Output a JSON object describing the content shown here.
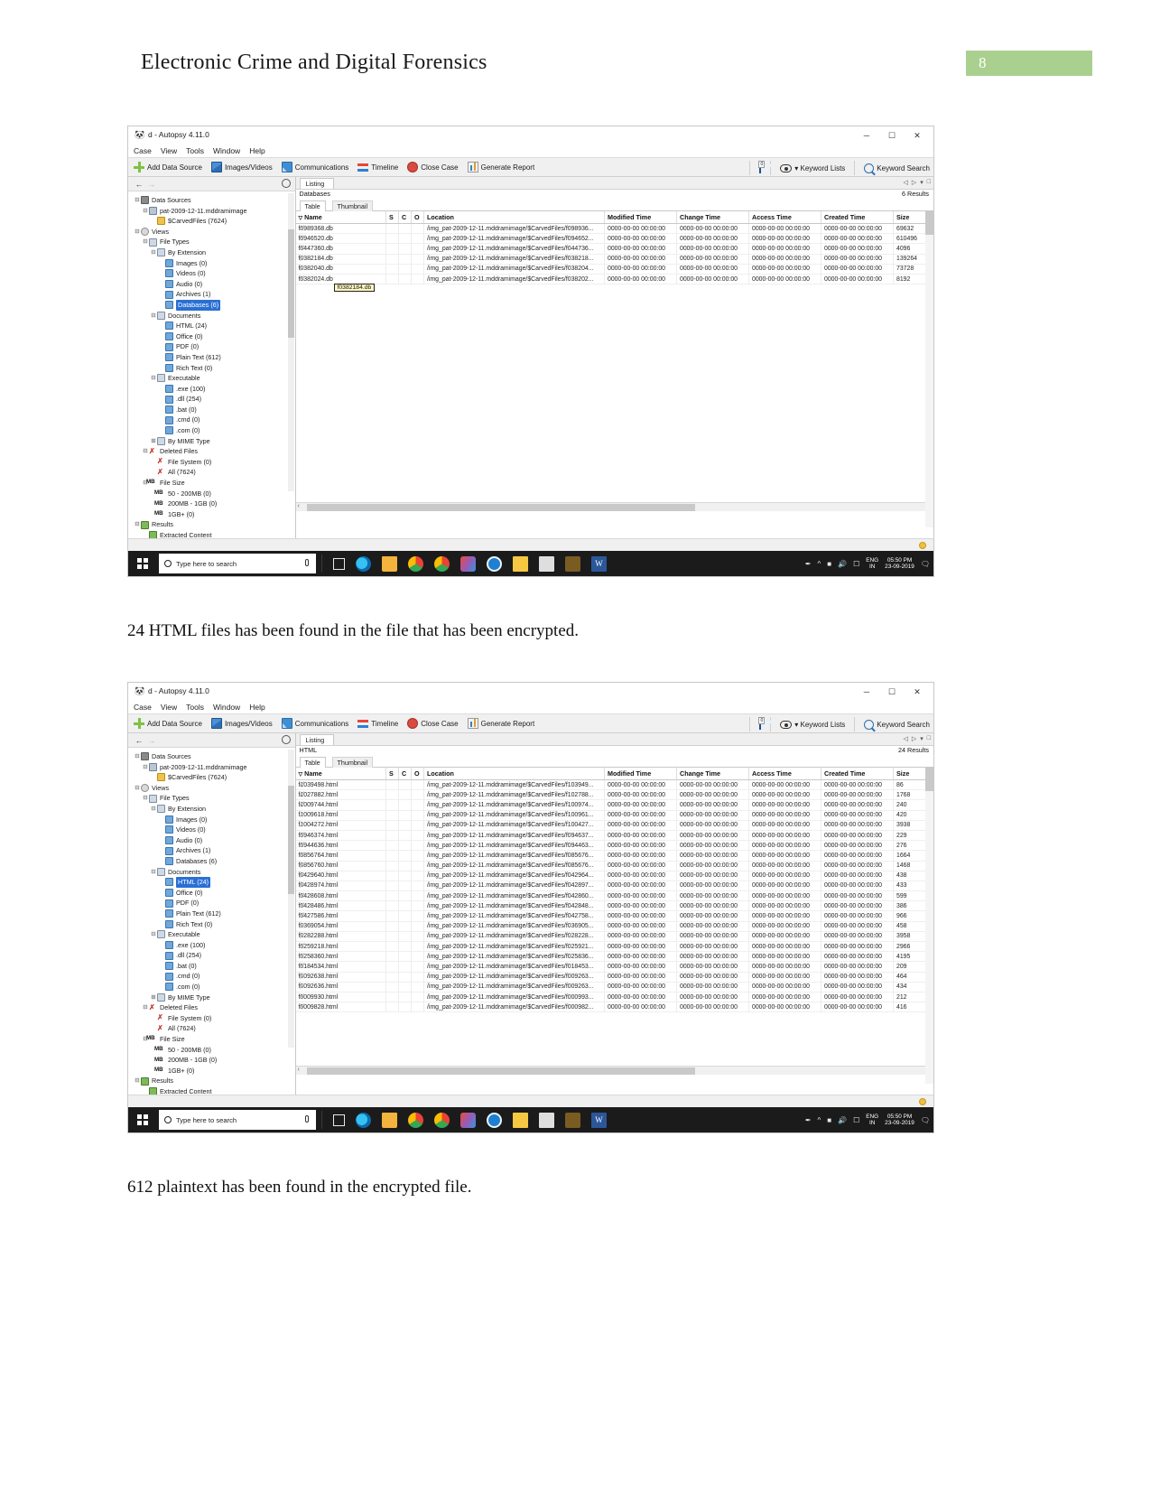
{
  "document": {
    "header_title": "Electronic Crime and Digital Forensics",
    "page_number": "8",
    "page_number_bg": "#a9d08e",
    "caption_1": "24 HTML files has been found in the file that has been encrypted.",
    "caption_2": "612 plaintext has been found in the encrypted file."
  },
  "app": {
    "title": "d - Autopsy 4.11.0",
    "menu": [
      "Case",
      "View",
      "Tools",
      "Window",
      "Help"
    ],
    "window_buttons": {
      "minimize": "─",
      "maximize": "☐",
      "close": "✕"
    },
    "toolbar": [
      {
        "label": "Add Data Source",
        "icon": "plus-icon"
      },
      {
        "label": "Images/Videos",
        "icon": "images-videos-icon"
      },
      {
        "label": "Communications",
        "icon": "communications-icon"
      },
      {
        "label": "Timeline",
        "icon": "timeline-icon"
      },
      {
        "label": "Close Case",
        "icon": "close-case-icon"
      },
      {
        "label": "Generate Report",
        "icon": "generate-report-icon"
      }
    ],
    "toolbar_right": {
      "mail_badge": "0",
      "keyword_lists": "▾ Keyword Lists",
      "keyword_search": "Keyword Search"
    },
    "nav": {
      "back": "←",
      "forward": "→"
    }
  },
  "tree": [
    {
      "depth": 0,
      "expander": "⊟",
      "icon": "drive-icon",
      "label": "Data Sources"
    },
    {
      "depth": 1,
      "expander": "⊟",
      "icon": "disk-icon",
      "label": "pat-2009-12-11.mddramimage"
    },
    {
      "depth": 2,
      "expander": "",
      "icon": "folder-icon",
      "label": "$CarvedFiles (7624)"
    },
    {
      "depth": 0,
      "expander": "⊟",
      "icon": "views-icon",
      "label": "Views"
    },
    {
      "depth": 1,
      "expander": "⊟",
      "icon": "types-icon",
      "label": "File Types"
    },
    {
      "depth": 2,
      "expander": "⊟",
      "icon": "types-icon",
      "label": "By Extension"
    },
    {
      "depth": 3,
      "expander": "",
      "icon": "file-icon",
      "label": "Images (0)"
    },
    {
      "depth": 3,
      "expander": "",
      "icon": "file-icon",
      "label": "Videos (0)"
    },
    {
      "depth": 3,
      "expander": "",
      "icon": "file-icon",
      "label": "Audio (0)"
    },
    {
      "depth": 3,
      "expander": "",
      "icon": "file-icon",
      "label": "Archives (1)"
    },
    {
      "depth": 3,
      "expander": "",
      "icon": "file-icon",
      "label": "Databases (6)"
    },
    {
      "depth": 2,
      "expander": "⊟",
      "icon": "types-icon",
      "label": "Documents"
    },
    {
      "depth": 3,
      "expander": "",
      "icon": "file-icon",
      "label": "HTML (24)"
    },
    {
      "depth": 3,
      "expander": "",
      "icon": "file-icon",
      "label": "Office (0)"
    },
    {
      "depth": 3,
      "expander": "",
      "icon": "file-icon",
      "label": "PDF (0)"
    },
    {
      "depth": 3,
      "expander": "",
      "icon": "file-icon",
      "label": "Plain Text (612)"
    },
    {
      "depth": 3,
      "expander": "",
      "icon": "file-icon",
      "label": "Rich Text (0)"
    },
    {
      "depth": 2,
      "expander": "⊟",
      "icon": "types-icon",
      "label": "Executable"
    },
    {
      "depth": 3,
      "expander": "",
      "icon": "file-icon",
      "label": ".exe (100)"
    },
    {
      "depth": 3,
      "expander": "",
      "icon": "file-icon",
      "label": ".dll (254)"
    },
    {
      "depth": 3,
      "expander": "",
      "icon": "file-icon",
      "label": ".bat (0)"
    },
    {
      "depth": 3,
      "expander": "",
      "icon": "file-icon",
      "label": ".cmd (0)"
    },
    {
      "depth": 3,
      "expander": "",
      "icon": "file-icon",
      "label": ".com (0)"
    },
    {
      "depth": 2,
      "expander": "⊞",
      "icon": "types-icon",
      "label": "By MIME Type"
    },
    {
      "depth": 1,
      "expander": "⊟",
      "icon": "deleted-icon",
      "label": "Deleted Files"
    },
    {
      "depth": 2,
      "expander": "",
      "icon": "deleted-icon",
      "label": "File System (0)"
    },
    {
      "depth": 2,
      "expander": "",
      "icon": "deleted-icon",
      "label": "All (7624)"
    },
    {
      "depth": 1,
      "expander": "⊟",
      "icon": "mb-icon",
      "label": "File Size"
    },
    {
      "depth": 2,
      "expander": "",
      "icon": "mb-icon",
      "label": "50 - 200MB (0)"
    },
    {
      "depth": 2,
      "expander": "",
      "icon": "mb-icon",
      "label": "200MB - 1GB (0)"
    },
    {
      "depth": 2,
      "expander": "",
      "icon": "mb-icon",
      "label": "1GB+ (0)"
    },
    {
      "depth": 0,
      "expander": "⊟",
      "icon": "results-icon",
      "label": "Results"
    },
    {
      "depth": 1,
      "expander": "",
      "icon": "results-icon",
      "label": "Extracted Content"
    }
  ],
  "listing": {
    "tab_label": "Listing",
    "view_tabs": {
      "active": "Table",
      "inactive": "Thumbnail"
    },
    "columns": [
      "Name",
      "S",
      "C",
      "O",
      "Location",
      "Modified Time",
      "Change Time",
      "Access Time",
      "Created Time",
      "Size"
    ]
  },
  "screenshot1": {
    "selected_tree_item": "Databases (6)",
    "listing_subtitle": "Databases",
    "results_count": "6 Results",
    "tooltip": "f0382184.db",
    "rows": [
      {
        "name": "f0989368.db",
        "location": "/img_pat-2009-12-11.mddramimage/$CarvedFiles/f098936...",
        "modified": "0000-00-00 00:00:00",
        "change": "0000-00-00 00:00:00",
        "access": "0000-00-00 00:00:00",
        "created": "0000-00-00 00:00:00",
        "size": "69632"
      },
      {
        "name": "f0946520.db",
        "location": "/img_pat-2009-12-11.mddramimage/$CarvedFiles/f094652...",
        "modified": "0000-00-00 00:00:00",
        "change": "0000-00-00 00:00:00",
        "access": "0000-00-00 00:00:00",
        "created": "0000-00-00 00:00:00",
        "size": "610496"
      },
      {
        "name": "f0447360.db",
        "location": "/img_pat-2009-12-11.mddramimage/$CarvedFiles/f044736...",
        "modified": "0000-00-00 00:00:00",
        "change": "0000-00-00 00:00:00",
        "access": "0000-00-00 00:00:00",
        "created": "0000-00-00 00:00:00",
        "size": "4096"
      },
      {
        "name": "f0382184.db",
        "location": "/img_pat-2009-12-11.mddramimage/$CarvedFiles/f038218...",
        "modified": "0000-00-00 00:00:00",
        "change": "0000-00-00 00:00:00",
        "access": "0000-00-00 00:00:00",
        "created": "0000-00-00 00:00:00",
        "size": "139264"
      },
      {
        "name": "f0382040.db",
        "location": "/img_pat-2009-12-11.mddramimage/$CarvedFiles/f038204...",
        "modified": "0000-00-00 00:00:00",
        "change": "0000-00-00 00:00:00",
        "access": "0000-00-00 00:00:00",
        "created": "0000-00-00 00:00:00",
        "size": "73728"
      },
      {
        "name": "f0382024.db",
        "location": "/img_pat-2009-12-11.mddramimage/$CarvedFiles/f038202...",
        "modified": "0000-00-00 00:00:00",
        "change": "0000-00-00 00:00:00",
        "access": "0000-00-00 00:00:00",
        "created": "0000-00-00 00:00:00",
        "size": "8192"
      }
    ]
  },
  "screenshot2": {
    "selected_tree_item": "HTML (24)",
    "listing_subtitle": "HTML",
    "results_count": "24 Results",
    "rows": [
      {
        "name": "f1039498.html",
        "location": "/img_pat-2009-12-11.mddramimage/$CarvedFiles/f103949...",
        "modified": "0000-00-00 00:00:00",
        "change": "0000-00-00 00:00:00",
        "access": "0000-00-00 00:00:00",
        "created": "0000-00-00 00:00:00",
        "size": "86"
      },
      {
        "name": "f1027882.html",
        "location": "/img_pat-2009-12-11.mddramimage/$CarvedFiles/f102788...",
        "modified": "0000-00-00 00:00:00",
        "change": "0000-00-00 00:00:00",
        "access": "0000-00-00 00:00:00",
        "created": "0000-00-00 00:00:00",
        "size": "1768"
      },
      {
        "name": "f1009744.html",
        "location": "/img_pat-2009-12-11.mddramimage/$CarvedFiles/f100974...",
        "modified": "0000-00-00 00:00:00",
        "change": "0000-00-00 00:00:00",
        "access": "0000-00-00 00:00:00",
        "created": "0000-00-00 00:00:00",
        "size": "240"
      },
      {
        "name": "f1009618.html",
        "location": "/img_pat-2009-12-11.mddramimage/$CarvedFiles/f100961...",
        "modified": "0000-00-00 00:00:00",
        "change": "0000-00-00 00:00:00",
        "access": "0000-00-00 00:00:00",
        "created": "0000-00-00 00:00:00",
        "size": "420"
      },
      {
        "name": "f1004272.html",
        "location": "/img_pat-2009-12-11.mddramimage/$CarvedFiles/f100427...",
        "modified": "0000-00-00 00:00:00",
        "change": "0000-00-00 00:00:00",
        "access": "0000-00-00 00:00:00",
        "created": "0000-00-00 00:00:00",
        "size": "3938"
      },
      {
        "name": "f0946374.html",
        "location": "/img_pat-2009-12-11.mddramimage/$CarvedFiles/f094637...",
        "modified": "0000-00-00 00:00:00",
        "change": "0000-00-00 00:00:00",
        "access": "0000-00-00 00:00:00",
        "created": "0000-00-00 00:00:00",
        "size": "229"
      },
      {
        "name": "f0944636.html",
        "location": "/img_pat-2009-12-11.mddramimage/$CarvedFiles/f094463...",
        "modified": "0000-00-00 00:00:00",
        "change": "0000-00-00 00:00:00",
        "access": "0000-00-00 00:00:00",
        "created": "0000-00-00 00:00:00",
        "size": "276"
      },
      {
        "name": "f0856764.html",
        "location": "/img_pat-2009-12-11.mddramimage/$CarvedFiles/f085676...",
        "modified": "0000-00-00 00:00:00",
        "change": "0000-00-00 00:00:00",
        "access": "0000-00-00 00:00:00",
        "created": "0000-00-00 00:00:00",
        "size": "1664"
      },
      {
        "name": "f0856760.html",
        "location": "/img_pat-2009-12-11.mddramimage/$CarvedFiles/f085676...",
        "modified": "0000-00-00 00:00:00",
        "change": "0000-00-00 00:00:00",
        "access": "0000-00-00 00:00:00",
        "created": "0000-00-00 00:00:00",
        "size": "1468"
      },
      {
        "name": "f0429640.html",
        "location": "/img_pat-2009-12-11.mddramimage/$CarvedFiles/f042964...",
        "modified": "0000-00-00 00:00:00",
        "change": "0000-00-00 00:00:00",
        "access": "0000-00-00 00:00:00",
        "created": "0000-00-00 00:00:00",
        "size": "438"
      },
      {
        "name": "f0428974.html",
        "location": "/img_pat-2009-12-11.mddramimage/$CarvedFiles/f042897...",
        "modified": "0000-00-00 00:00:00",
        "change": "0000-00-00 00:00:00",
        "access": "0000-00-00 00:00:00",
        "created": "0000-00-00 00:00:00",
        "size": "433"
      },
      {
        "name": "f0428608.html",
        "location": "/img_pat-2009-12-11.mddramimage/$CarvedFiles/f042860...",
        "modified": "0000-00-00 00:00:00",
        "change": "0000-00-00 00:00:00",
        "access": "0000-00-00 00:00:00",
        "created": "0000-00-00 00:00:00",
        "size": "599"
      },
      {
        "name": "f0428486.html",
        "location": "/img_pat-2009-12-11.mddramimage/$CarvedFiles/f042848...",
        "modified": "0000-00-00 00:00:00",
        "change": "0000-00-00 00:00:00",
        "access": "0000-00-00 00:00:00",
        "created": "0000-00-00 00:00:00",
        "size": "386"
      },
      {
        "name": "f0427586.html",
        "location": "/img_pat-2009-12-11.mddramimage/$CarvedFiles/f042758...",
        "modified": "0000-00-00 00:00:00",
        "change": "0000-00-00 00:00:00",
        "access": "0000-00-00 00:00:00",
        "created": "0000-00-00 00:00:00",
        "size": "966"
      },
      {
        "name": "f0369054.html",
        "location": "/img_pat-2009-12-11.mddramimage/$CarvedFiles/f036905...",
        "modified": "0000-00-00 00:00:00",
        "change": "0000-00-00 00:00:00",
        "access": "0000-00-00 00:00:00",
        "created": "0000-00-00 00:00:00",
        "size": "458"
      },
      {
        "name": "f0282288.html",
        "location": "/img_pat-2009-12-11.mddramimage/$CarvedFiles/f028228...",
        "modified": "0000-00-00 00:00:00",
        "change": "0000-00-00 00:00:00",
        "access": "0000-00-00 00:00:00",
        "created": "0000-00-00 00:00:00",
        "size": "3958"
      },
      {
        "name": "f0259218.html",
        "location": "/img_pat-2009-12-11.mddramimage/$CarvedFiles/f025921...",
        "modified": "0000-00-00 00:00:00",
        "change": "0000-00-00 00:00:00",
        "access": "0000-00-00 00:00:00",
        "created": "0000-00-00 00:00:00",
        "size": "2966"
      },
      {
        "name": "f0258360.html",
        "location": "/img_pat-2009-12-11.mddramimage/$CarvedFiles/f025836...",
        "modified": "0000-00-00 00:00:00",
        "change": "0000-00-00 00:00:00",
        "access": "0000-00-00 00:00:00",
        "created": "0000-00-00 00:00:00",
        "size": "4195"
      },
      {
        "name": "f0184534.html",
        "location": "/img_pat-2009-12-11.mddramimage/$CarvedFiles/f018453...",
        "modified": "0000-00-00 00:00:00",
        "change": "0000-00-00 00:00:00",
        "access": "0000-00-00 00:00:00",
        "created": "0000-00-00 00:00:00",
        "size": "209"
      },
      {
        "name": "f0092638.html",
        "location": "/img_pat-2009-12-11.mddramimage/$CarvedFiles/f009263...",
        "modified": "0000-00-00 00:00:00",
        "change": "0000-00-00 00:00:00",
        "access": "0000-00-00 00:00:00",
        "created": "0000-00-00 00:00:00",
        "size": "464"
      },
      {
        "name": "f0092636.html",
        "location": "/img_pat-2009-12-11.mddramimage/$CarvedFiles/f009263...",
        "modified": "0000-00-00 00:00:00",
        "change": "0000-00-00 00:00:00",
        "access": "0000-00-00 00:00:00",
        "created": "0000-00-00 00:00:00",
        "size": "434"
      },
      {
        "name": "f0009930.html",
        "location": "/img_pat-2009-12-11.mddramimage/$CarvedFiles/f000993...",
        "modified": "0000-00-00 00:00:00",
        "change": "0000-00-00 00:00:00",
        "access": "0000-00-00 00:00:00",
        "created": "0000-00-00 00:00:00",
        "size": "212"
      },
      {
        "name": "f0009828.html",
        "location": "/img_pat-2009-12-11.mddramimage/$CarvedFiles/f000982...",
        "modified": "0000-00-00 00:00:00",
        "change": "0000-00-00 00:00:00",
        "access": "0000-00-00 00:00:00",
        "created": "0000-00-00 00:00:00",
        "size": "416"
      }
    ]
  },
  "taskbar": {
    "search_placeholder": "Type here to search",
    "language": "ENG",
    "region": "IN",
    "time": "05:50 PM",
    "date": "23-09-2019",
    "apps": [
      {
        "name": "task-view-icon"
      },
      {
        "name": "edge-icon"
      },
      {
        "name": "file-explorer-icon"
      },
      {
        "name": "chrome-icon"
      },
      {
        "name": "chrome-canary-icon"
      },
      {
        "name": "paint-icon"
      },
      {
        "name": "photos-icon"
      },
      {
        "name": "notes-icon"
      },
      {
        "name": "calculator-icon"
      },
      {
        "name": "autopsy-icon"
      },
      {
        "name": "word-icon",
        "glyph": "W"
      }
    ]
  }
}
